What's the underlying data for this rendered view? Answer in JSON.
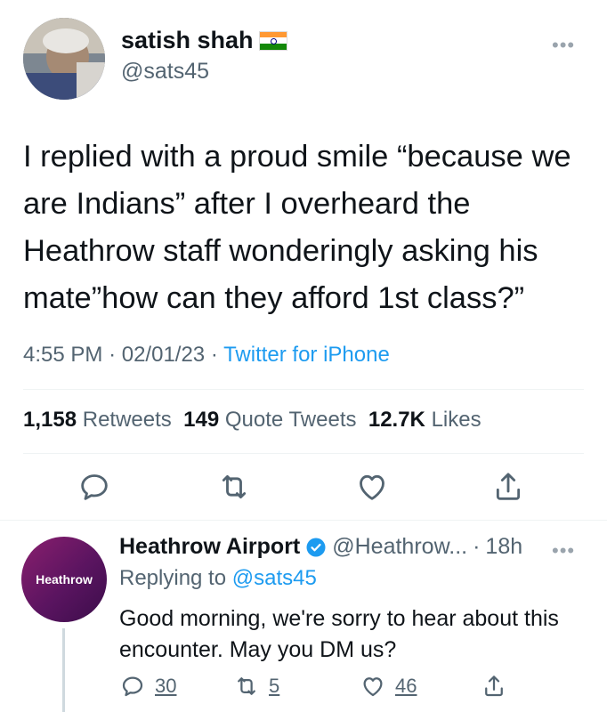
{
  "tweet": {
    "author_name": "satish shah",
    "author_handle": "@sats45",
    "text": "I replied with a proud smile “because we are Indians” after I overheard the Heathrow staff wonderingly asking his mate”how can they afford 1st class?”",
    "time": "4:55 PM",
    "sep1": "·",
    "date": "02/01/23",
    "sep2": "·",
    "source": "Twitter for iPhone",
    "more": "•••",
    "stats": {
      "retweets_count": "1,158",
      "retweets_label": "Retweets",
      "quotes_count": "149",
      "quotes_label": "Quote Tweets",
      "likes_count": "12.7K",
      "likes_label": "Likes"
    },
    "icons": [
      "reply-icon",
      "retweet-icon",
      "like-icon",
      "share-icon"
    ]
  },
  "reply": {
    "author_name": "Heathrow Airport",
    "author_handle": "@Heathrow...",
    "sep": "·",
    "time": "18h",
    "more": "•••",
    "avatar_text": "Heathrow",
    "replying_prefix": "Replying to",
    "replying_to": "@sats45",
    "text": "Good morning, we're sorry to hear about this encounter. May you DM us?",
    "reply_count": "30",
    "retweet_count": "5",
    "like_count": "46",
    "colors": {
      "verified": "#1d9bf0",
      "avatar": "#5a1460"
    }
  },
  "colors": {
    "link": "#1d9bf0",
    "secondary": "#536471",
    "text": "#0f1419"
  }
}
